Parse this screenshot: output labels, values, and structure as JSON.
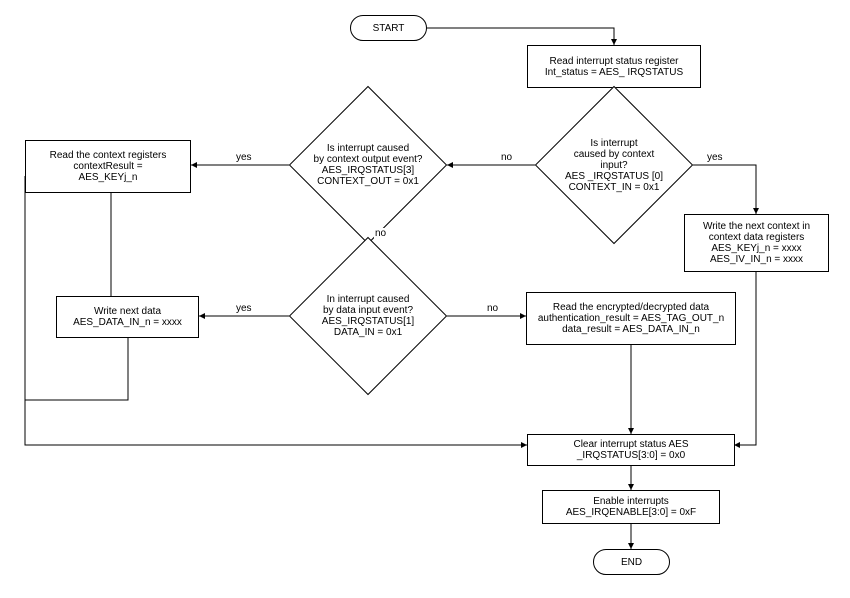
{
  "flow": {
    "start": "START",
    "end": "END",
    "readStatus": {
      "l1": "Read interrupt status register",
      "l2": "Int_status = AES_ IRQSTATUS"
    },
    "d_contextIn": {
      "l1": "Is interrupt",
      "l2": "caused by context input?",
      "l3": "AES _IRQSTATUS [0]",
      "l4": "CONTEXT_IN = 0x1"
    },
    "d_contextOut": {
      "l1": "Is interrupt caused",
      "l2": "by context output event?",
      "l3": "AES_IRQSTATUS[3]",
      "l4": "CONTEXT_OUT = 0x1"
    },
    "d_dataIn": {
      "l1": "In interrupt caused",
      "l2": "by data input event?",
      "l3": "AES_IRQSTATUS[1]",
      "l4": "DATA_IN = 0x1"
    },
    "readContext": {
      "l1": "Read the context registers",
      "l2": "contextResult =",
      "l3": "AES_KEYj_n"
    },
    "writeContext": {
      "l1": "Write the next context in",
      "l2": "context data registers",
      "l3": "AES_KEYj_n = xxxx",
      "l4": "AES_IV_IN_n = xxxx"
    },
    "writeData": {
      "l1": "Write next data",
      "l2": "AES_DATA_IN_n = xxxx"
    },
    "readData": {
      "l1": "Read the encrypted/decrypted data",
      "l2": "authentication_result = AES_TAG_OUT_n",
      "l3": "data_result = AES_DATA_IN_n"
    },
    "clearIrq": {
      "l1": "Clear interrupt status AES",
      "l2": "_IRQSTATUS[3:0] = 0x0"
    },
    "enableIrq": {
      "l1": "Enable interrupts",
      "l2": "AES_IRQENABLE[3:0]  = 0xF"
    }
  },
  "labels": {
    "yes": "yes",
    "no": "no"
  }
}
